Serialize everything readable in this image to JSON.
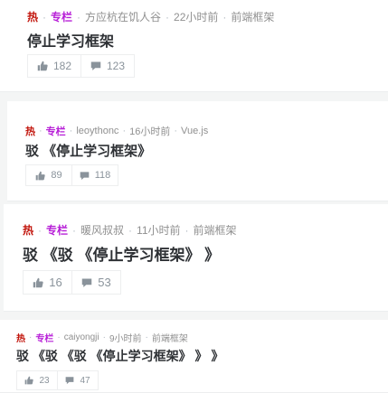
{
  "feed": {
    "tags": {
      "hot": "热",
      "column": "专栏"
    },
    "separator": "·",
    "entries": [
      {
        "author": "方应杭在饥人谷",
        "time": "22小时前",
        "category": "前端框架",
        "title": "停止学习框架",
        "likes": "182",
        "comments": "123"
      },
      {
        "author": "leoythonc",
        "time": "16小时前",
        "category": "Vue.js",
        "title": "驳 《停止学习框架》",
        "likes": "89",
        "comments": "118"
      },
      {
        "author": "暖风叔叔",
        "time": "11小时前",
        "category": "前端框架",
        "title": "驳 《驳 《停止学习框架》 》",
        "likes": "16",
        "comments": "53"
      },
      {
        "author": "caiyongji",
        "time": "9小时前",
        "category": "前端框架",
        "title": "驳 《驳 《驳 《停止学习框架》 》 》",
        "likes": "23",
        "comments": "47"
      }
    ]
  },
  "icons": {
    "like": "thumbs-up-icon",
    "comment": "comment-icon"
  },
  "colors": {
    "hot": "#c2160d",
    "column": "#b71ed7",
    "meta": "#909090",
    "title": "#2e3135",
    "action": "#8a939b",
    "background": "#f4f5f5"
  }
}
